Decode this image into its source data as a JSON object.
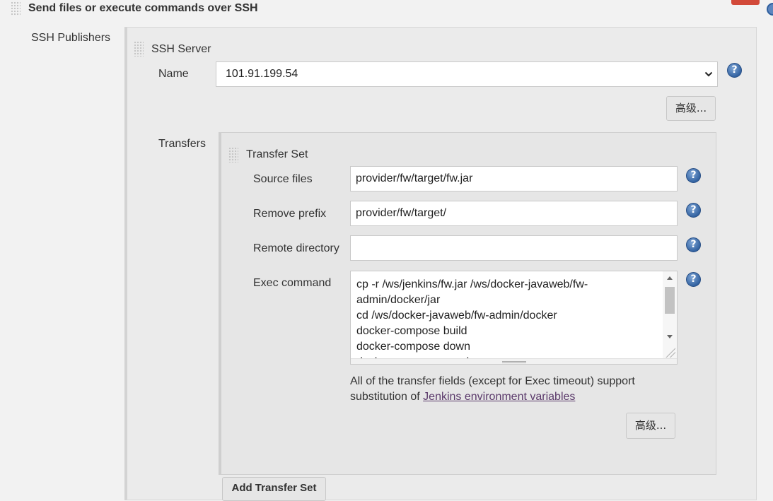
{
  "section": {
    "title": "Send files or execute commands over SSH"
  },
  "publishers": {
    "label": "SSH Publishers"
  },
  "ssh_server": {
    "header": "SSH Server",
    "name_label": "Name",
    "name_value": "101.91.199.54",
    "advanced_button": "高级..."
  },
  "transfers": {
    "label": "Transfers",
    "set_header": "Transfer Set",
    "source_files_label": "Source files",
    "source_files_value": "provider/fw/target/fw.jar",
    "remove_prefix_label": "Remove prefix",
    "remove_prefix_value": "provider/fw/target/",
    "remote_directory_label": "Remote directory",
    "remote_directory_value": "",
    "exec_command_label": "Exec command",
    "exec_command_lines": [
      "cp -r /ws/jenkins/fw.jar /ws/docker-javaweb/fw-",
      "admin/docker/jar",
      "cd /ws/docker-javaweb/fw-admin/docker",
      "docker-compose build",
      "docker-compose down",
      "docker-compose up -d"
    ],
    "note_text_1": "All of the transfer fields (except for Exec timeout) support",
    "note_text_2": "substitution of ",
    "note_link": "Jenkins environment variables",
    "advanced_button": "高级...",
    "add_button": "Add Transfer Set"
  },
  "icons": {
    "help": "help-icon",
    "dropdown": "chevron-down-icon",
    "drag": "drag-grip-icon",
    "delete": "delete-button-icon"
  },
  "colors": {
    "help_blue": "#2f5f9e",
    "delete_red": "#d24939",
    "link": "#5b3a6b"
  }
}
